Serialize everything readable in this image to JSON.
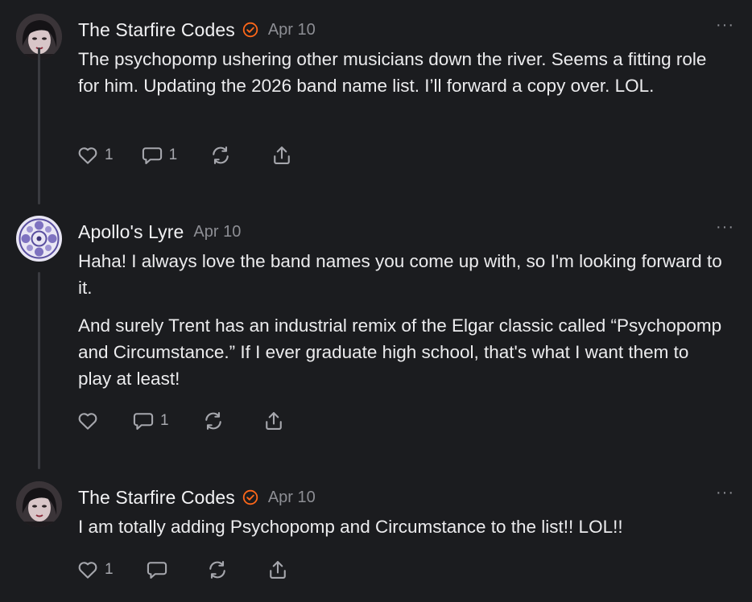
{
  "comments": [
    {
      "author": "The Starfire Codes",
      "verified": true,
      "date": "Apr 10",
      "more": "···",
      "paragraphs": [
        "The psychopomp ushering other musicians down the river. Seems a fitting role for him. Updating the 2026 band name list. I’ll forward a copy over. LOL."
      ],
      "likes": "1",
      "replies": "1"
    },
    {
      "author": "Apollo's Lyre",
      "verified": false,
      "date": "Apr 10",
      "more": "···",
      "paragraphs": [
        "Haha! I always love the band names you come up with, so I'm looking forward to it.",
        "And surely Trent has an industrial remix of the Elgar classic called “Psychopomp and Circumstance.” If I ever graduate high school, that's what I want them to play at least!"
      ],
      "likes": "",
      "replies": "1"
    },
    {
      "author": "The Starfire Codes",
      "verified": true,
      "date": "Apr 10",
      "more": "···",
      "paragraphs": [
        "I am totally adding Psychopomp and Circumstance to the list!! LOL!!"
      ],
      "likes": "1",
      "replies": ""
    }
  ],
  "icons": {
    "like": "heart-icon",
    "reply": "comment-bubble-icon",
    "restack": "restack-icon",
    "share": "share-icon",
    "verified": "verified-badge-icon",
    "more": "more-options-icon"
  },
  "colors": {
    "background": "#1b1c1f",
    "text": "#ececee",
    "muted": "#8d8e94",
    "verified": "#ff6719",
    "thread_line": "#3a3b40"
  }
}
